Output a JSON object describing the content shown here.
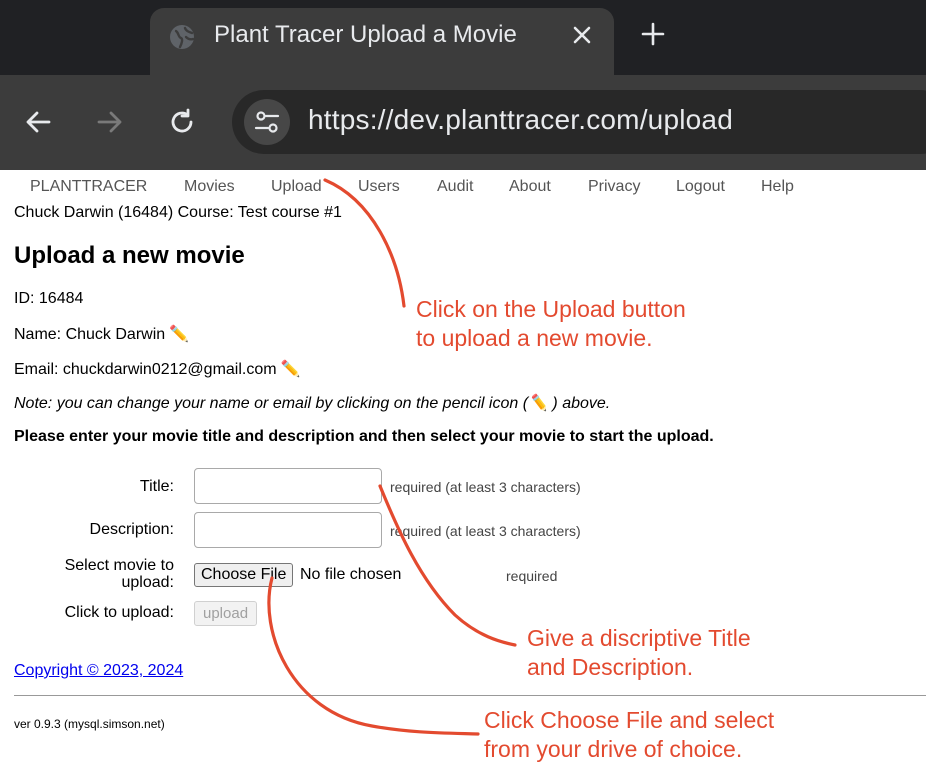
{
  "browser": {
    "tab_title": "Plant Tracer Upload a Movie",
    "url": "https://dev.planttracer.com/upload"
  },
  "nav": {
    "items": [
      "PLANTTRACER",
      "Movies",
      "Upload",
      "Users",
      "Audit",
      "About",
      "Privacy",
      "Logout",
      "Help"
    ]
  },
  "user": {
    "header_line": "Chuck Darwin (16484) Course: Test course #1",
    "id_line": "ID: 16484",
    "name_line": "Name: Chuck Darwin",
    "email_line": "Email: chuckdarwin0212@gmail.com"
  },
  "page": {
    "title": "Upload a new movie",
    "note_before": "Note: you can change your name or email by clicking on the pencil icon (",
    "note_after": " ) above.",
    "instructions": "Please enter your movie title and description and then select your movie to start the upload."
  },
  "form": {
    "title_label": "Title:",
    "title_value": "",
    "title_hint": "required (at least 3 characters)",
    "description_label": "Description:",
    "description_value": "",
    "description_hint": "required (at least 3 characters)",
    "file_label_line1": "Select movie to",
    "file_label_line2": "upload:",
    "file_button": "Choose File",
    "file_status": "No file chosen",
    "file_hint": "required",
    "upload_label": "Click to upload:",
    "upload_button": "upload"
  },
  "footer": {
    "copyright": "Copyright © 2023, 2024",
    "version": "ver 0.9.3 (mysql.simson.net)"
  },
  "annotations": {
    "upload_line1": "Click on the Upload button",
    "upload_line2": "to upload a new movie.",
    "title_line1": "Give a discriptive Title",
    "title_line2": "and Description.",
    "file_line1": "Click Choose File and select",
    "file_line2": "from your drive of choice."
  },
  "colors": {
    "chrome_dark": "#202124",
    "chrome_toolbar": "#3c3c3c",
    "annotation": "#e34a2f",
    "link": "#0000ee"
  },
  "icons": {
    "tab": "globe-icon",
    "close": "close-icon",
    "new_tab": "plus-icon",
    "back": "back-arrow-icon",
    "forward": "forward-arrow-icon",
    "reload": "reload-icon",
    "site_settings": "tune-icon",
    "edit": "pencil-icon"
  }
}
